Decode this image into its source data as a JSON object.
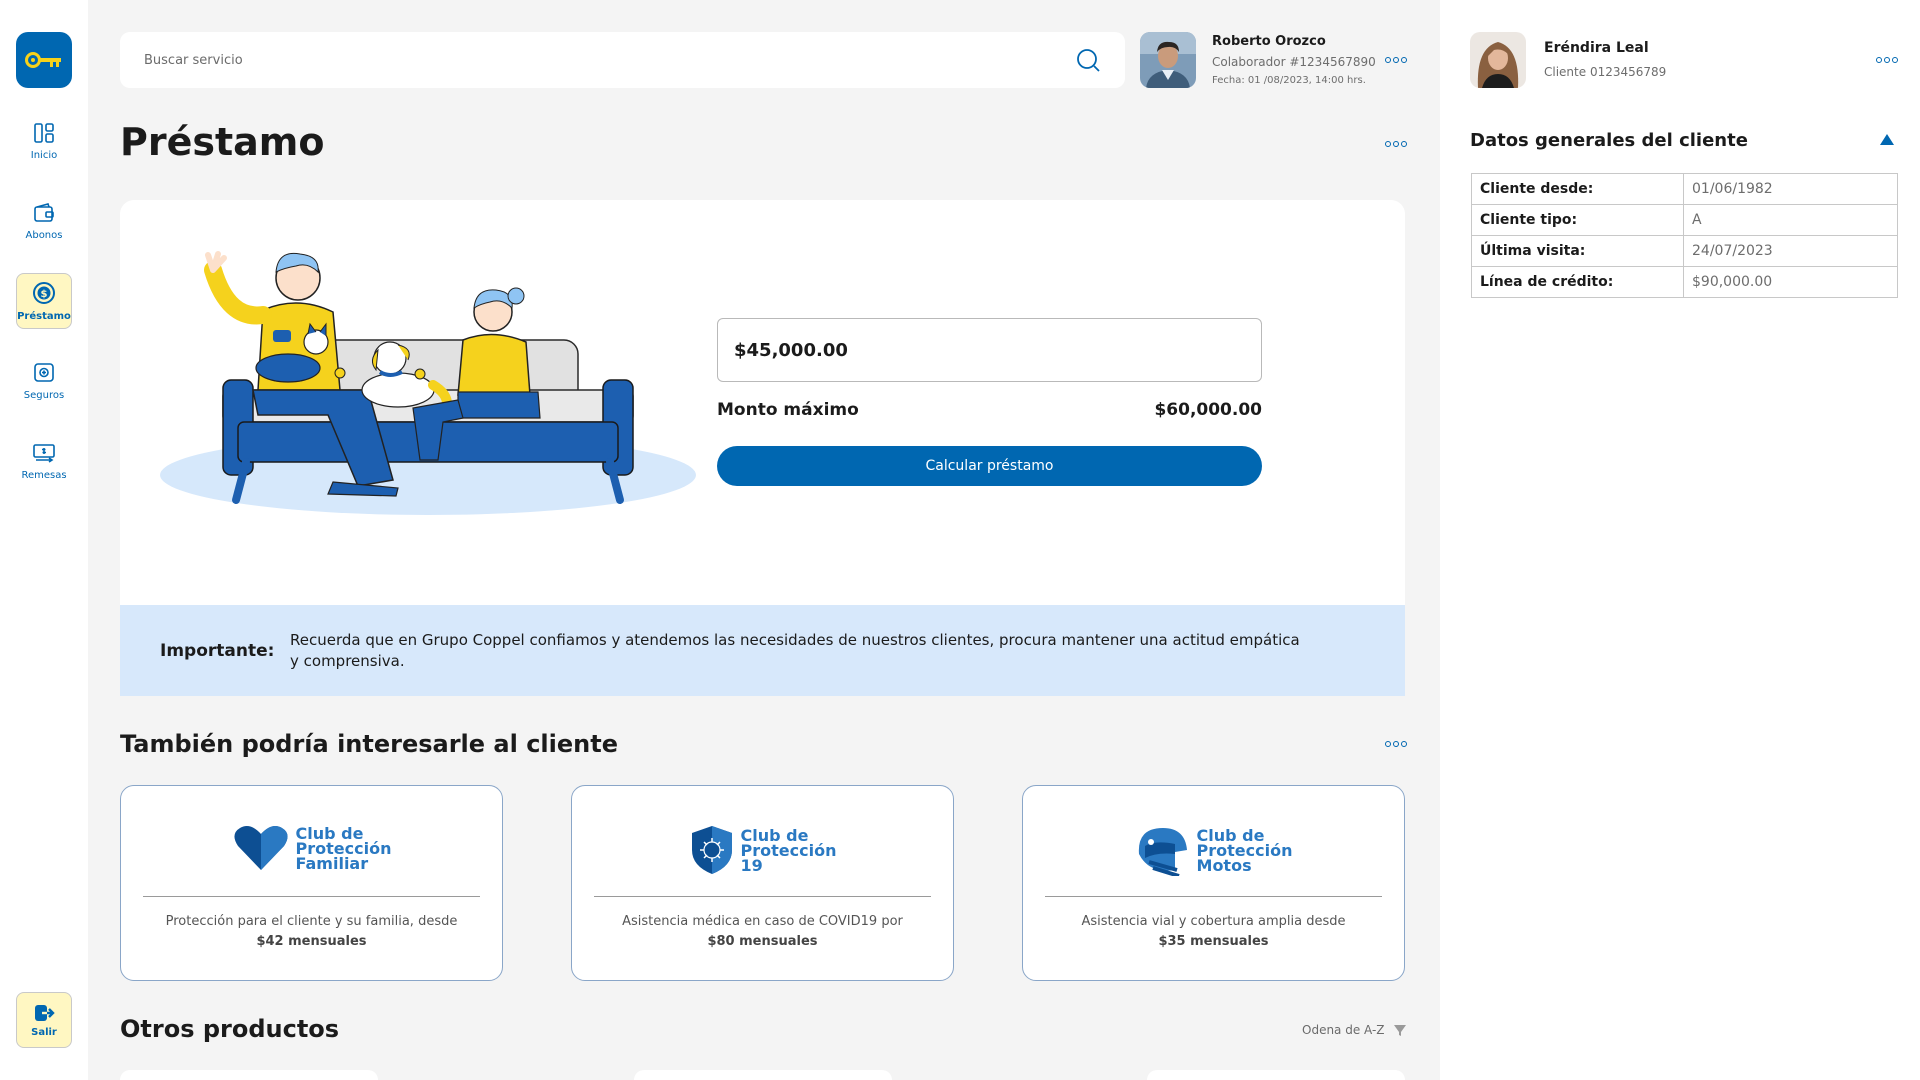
{
  "sidebar": {
    "logo_icon": "key-icon",
    "items": [
      {
        "label": "Inicio",
        "icon": "dashboard-icon"
      },
      {
        "label": "Abonos",
        "icon": "wallet-icon"
      },
      {
        "label": "Préstamo",
        "icon": "dollar-coin-icon"
      },
      {
        "label": "Seguros",
        "icon": "safe-icon"
      },
      {
        "label": "Remesas",
        "icon": "money-transfer-icon"
      }
    ],
    "exit_label": "Salir"
  },
  "search": {
    "placeholder": "Buscar servicio"
  },
  "collaborator": {
    "name": "Roberto Orozco",
    "id": "Colaborador #1234567890",
    "date": "Fecha: 01 /08/2023, 14:00 hrs."
  },
  "page": {
    "title": "Préstamo"
  },
  "loan": {
    "amount": "$45,000.00",
    "max_label": "Monto máximo",
    "max_value": "$60,000.00",
    "button": "Calcular préstamo"
  },
  "notice": {
    "title": "Importante:",
    "text": "Recuerda que en Grupo Coppel confiamos y atendemos las necesidades de nuestros clientes, procura mantener una actitud empática y comprensiva."
  },
  "recommended": {
    "title": "También podría interesarle al cliente",
    "products": [
      {
        "name_lines": [
          "Club de",
          "Protección",
          "Familiar"
        ],
        "desc": "Protección para el cliente y su familia, desde",
        "price": "$42 mensuales"
      },
      {
        "name_lines": [
          "Club de",
          "Protección",
          "19"
        ],
        "desc": "Asistencia médica en caso de COVID19 por",
        "price": "$80 mensuales"
      },
      {
        "name_lines": [
          "Club de",
          "Protección",
          "Motos"
        ],
        "desc": "Asistencia vial y cobertura amplia desde",
        "price": "$35 mensuales"
      }
    ]
  },
  "others": {
    "title": "Otros productos",
    "sort_label": "Odena de A-Z"
  },
  "client": {
    "name": "Eréndira Leal",
    "id": "Cliente 0123456789",
    "section_title": "Datos generales del cliente",
    "rows": [
      {
        "k": "Cliente desde:",
        "v": "01/06/1982"
      },
      {
        "k": "Cliente tipo:",
        "v": "A"
      },
      {
        "k": "Última visita:",
        "v": "24/07/2023"
      },
      {
        "k": "Línea de crédito:",
        "v": "$90,000.00"
      }
    ]
  },
  "colors": {
    "brand_blue": "#0067b1",
    "accent_yellow": "#fff7c2",
    "notice_bg": "#d7e8fb"
  }
}
